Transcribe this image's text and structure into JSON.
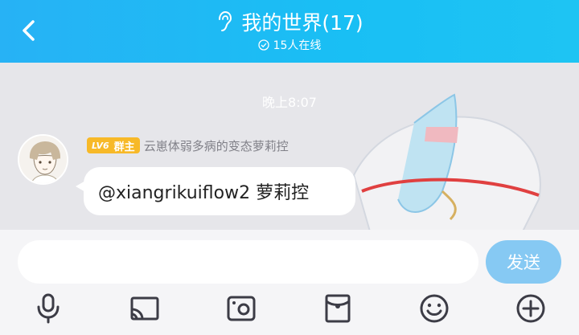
{
  "header": {
    "title": "我的世界(17)",
    "online": "15人在线"
  },
  "chat": {
    "timestamp": "晚上8:07",
    "message": {
      "level_badge": "LV6",
      "role_badge": "群主",
      "sender": "云崽体弱多病的变态萝莉控",
      "text": "@xiangrikuiflow2  萝莉控"
    }
  },
  "composer": {
    "input_value": "",
    "send_label": "发送"
  },
  "toolbar": {
    "icons": [
      "microphone-icon",
      "screen-cast-icon",
      "photo-icon",
      "red-packet-icon",
      "emoji-icon",
      "plus-icon"
    ]
  },
  "colors": {
    "header_blue": "#1ebcf4",
    "send_button": "#86c9f3",
    "badge_gold": "#f7b928",
    "icon_gray": "#3c3c46"
  }
}
